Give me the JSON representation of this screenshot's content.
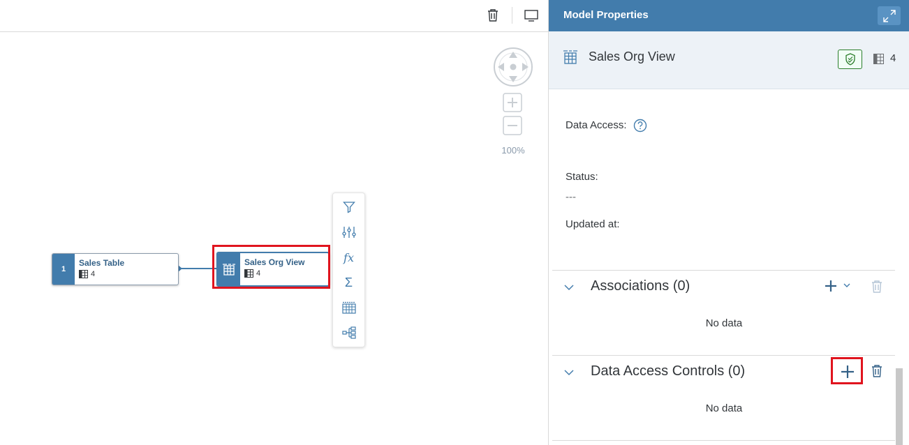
{
  "canvas": {
    "zoom_level": "100%",
    "nodes": {
      "sales_table": {
        "index": "1",
        "title": "Sales Table",
        "column_count": "4"
      },
      "sales_org_view": {
        "title": "Sales Org View",
        "column_count": "4"
      }
    },
    "node_toolbar": [
      "filter-icon",
      "column-settings-icon",
      "calculated-column-icon",
      "aggregation-icon",
      "table-columns-icon",
      "hierarchy-icon"
    ]
  },
  "panel": {
    "title": "Model Properties",
    "object": {
      "name": "Sales Org View",
      "column_count": "4"
    },
    "fields": {
      "data_access_label": "Data Access:",
      "status_label": "Status:",
      "status_value": "---",
      "updated_label": "Updated at:"
    },
    "sections": {
      "associations": {
        "title": "Associations (0)",
        "empty_text": "No data"
      },
      "data_access_controls": {
        "title": "Data Access Controls (0)",
        "empty_text": "No data"
      }
    }
  },
  "colors": {
    "accent": "#427cac",
    "highlight": "#e0141e",
    "header_bg": "#edf2f7",
    "success": "#2b7d2b"
  }
}
